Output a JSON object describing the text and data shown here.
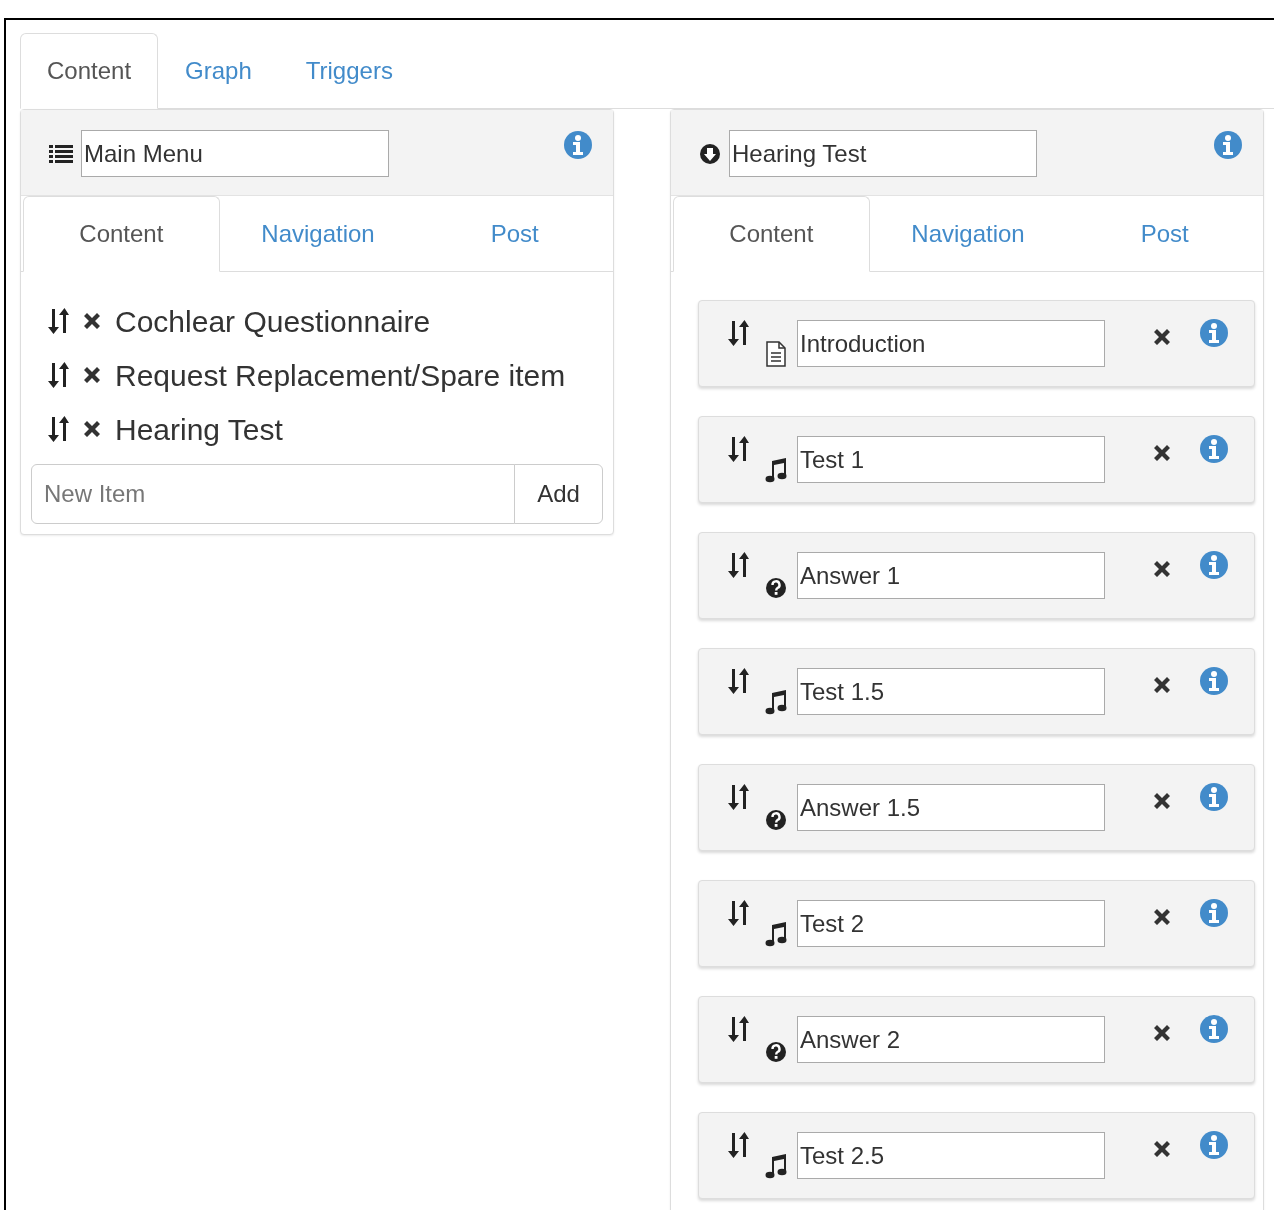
{
  "tabs": [
    {
      "label": "Content",
      "selected": true
    },
    {
      "label": "Graph",
      "selected": false
    },
    {
      "label": "Triggers",
      "selected": false
    }
  ],
  "left_panel": {
    "kind": "list",
    "title": "Main Menu",
    "tabs": [
      {
        "label": "Content",
        "selected": true
      },
      {
        "label": "Navigation",
        "selected": false
      },
      {
        "label": "Post",
        "selected": false
      }
    ],
    "items": [
      {
        "label": "Cochlear Questionnaire"
      },
      {
        "label": "Request Replacement/Spare item"
      },
      {
        "label": "Hearing Test"
      }
    ],
    "new_item": {
      "placeholder": "New Item"
    },
    "add_button": "Add"
  },
  "right_panel": {
    "kind": "circle-down",
    "title": "Hearing Test",
    "tabs": [
      {
        "label": "Content",
        "selected": true
      },
      {
        "label": "Navigation",
        "selected": false
      },
      {
        "label": "Post",
        "selected": false
      }
    ],
    "items": [
      {
        "kind": "document",
        "value": "Introduction"
      },
      {
        "kind": "music",
        "value": "Test 1"
      },
      {
        "kind": "question",
        "value": "Answer 1"
      },
      {
        "kind": "music",
        "value": "Test 1.5"
      },
      {
        "kind": "question",
        "value": "Answer 1.5"
      },
      {
        "kind": "music",
        "value": "Test 2"
      },
      {
        "kind": "question",
        "value": "Answer 2"
      },
      {
        "kind": "music",
        "value": "Test 2.5"
      }
    ]
  }
}
